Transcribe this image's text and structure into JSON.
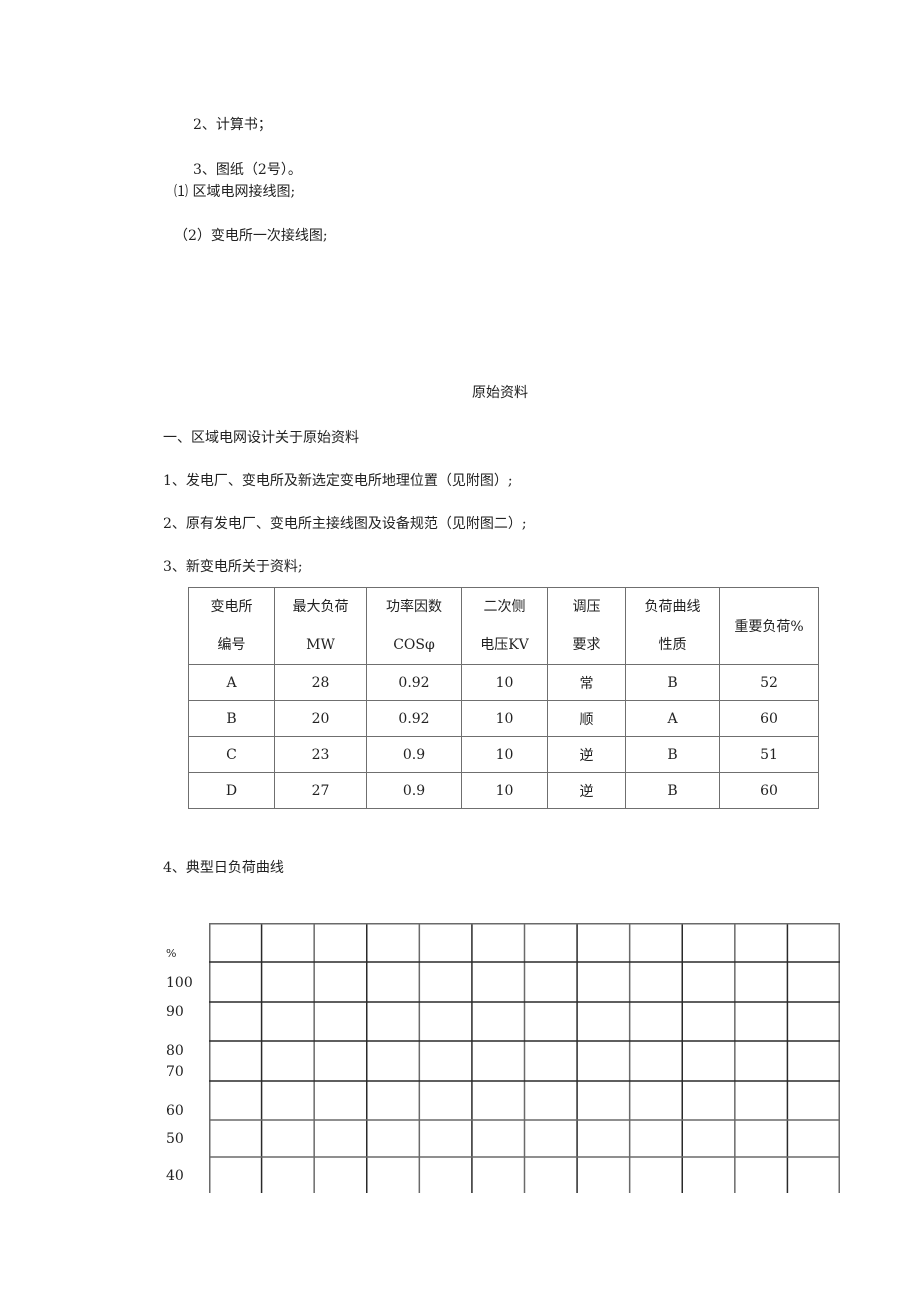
{
  "deliverables": [
    "2、计算书；",
    "3、图纸（2号）。",
    "⑴  区域电网接线图;",
    "（2）变电所一次接线图;"
  ],
  "section_title": "原始资料",
  "part_heading": "一、区域电网设计关于原始资料",
  "items": [
    "1、发电厂、变电所及新选定变电所地理位置（见附图）;",
    "2、原有发电厂、变电所主接线图及设备规范（见附图二）;",
    "3、新变电所关于资料;"
  ],
  "table": {
    "headers": [
      [
        "变电所",
        "编号"
      ],
      [
        "最大负荷",
        "MW"
      ],
      [
        "功率因数",
        "COSφ"
      ],
      [
        "二次侧",
        "电压KV"
      ],
      [
        "调压",
        "要求"
      ],
      [
        "负荷曲线",
        "性质"
      ],
      [
        "重要负荷%"
      ]
    ],
    "rows": [
      [
        "A",
        "28",
        "0.92",
        "10",
        "常",
        "B",
        "52"
      ],
      [
        "B",
        "20",
        "0.92",
        "10",
        "顺",
        "A",
        "60"
      ],
      [
        "C",
        "23",
        "0.9",
        "10",
        "逆",
        "B",
        "51"
      ],
      [
        "D",
        "27",
        "0.9",
        "10",
        "逆",
        "B",
        "60"
      ]
    ]
  },
  "load_curve": {
    "heading": "4、典型日负荷曲线",
    "unit_label": "%",
    "y_labels": [
      "100",
      "90",
      "80",
      "70",
      "60",
      "50",
      "40"
    ],
    "grid_columns": 12,
    "grid_rows": 7
  }
}
